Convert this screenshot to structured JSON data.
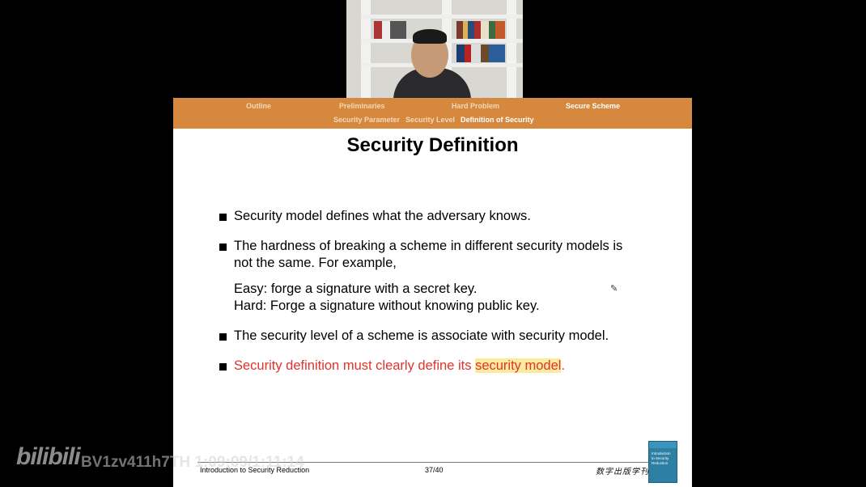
{
  "nav": {
    "sections": [
      {
        "label": "Outline",
        "active": false
      },
      {
        "label": "Preliminaries",
        "active": false
      },
      {
        "label": "Hard Problem",
        "active": false
      },
      {
        "label": "Secure Scheme",
        "active": true
      }
    ],
    "subsections": [
      {
        "label": "Security Parameter",
        "active": false
      },
      {
        "label": "Security Level",
        "active": false
      },
      {
        "label": "Definition of Security",
        "active": true
      }
    ]
  },
  "slide": {
    "title": "Security Definition",
    "bullets": [
      {
        "text": "Security model defines what the adversary knows."
      },
      {
        "line1": "The hardness of breaking a scheme in different security models is",
        "line2": "not the same. For example,"
      },
      {
        "text": "The security level of a scheme is associate with security model."
      },
      {
        "text_before": "Security definition must clearly define its",
        "highlight": "security model",
        "text_after": "."
      }
    ],
    "example_lines": [
      "Easy: forge a signature with a secret key.",
      "Hard: Forge a signature without knowing public key."
    ],
    "text_color_alert": "#e0332b",
    "highlight_color": "#fbeb9e"
  },
  "footer": {
    "left": "Introduction to Security Reduction",
    "page": "37/40",
    "publisher": "数字出版学刊"
  },
  "book_cover": {
    "text": "Introduction to Security Reduction"
  },
  "watermark": {
    "logo": "bilibili",
    "id": "BV1zv411h7TH 1:09:09/1:11:14"
  },
  "colors": {
    "nav_bar": "#d6883e",
    "background": "#000000"
  }
}
